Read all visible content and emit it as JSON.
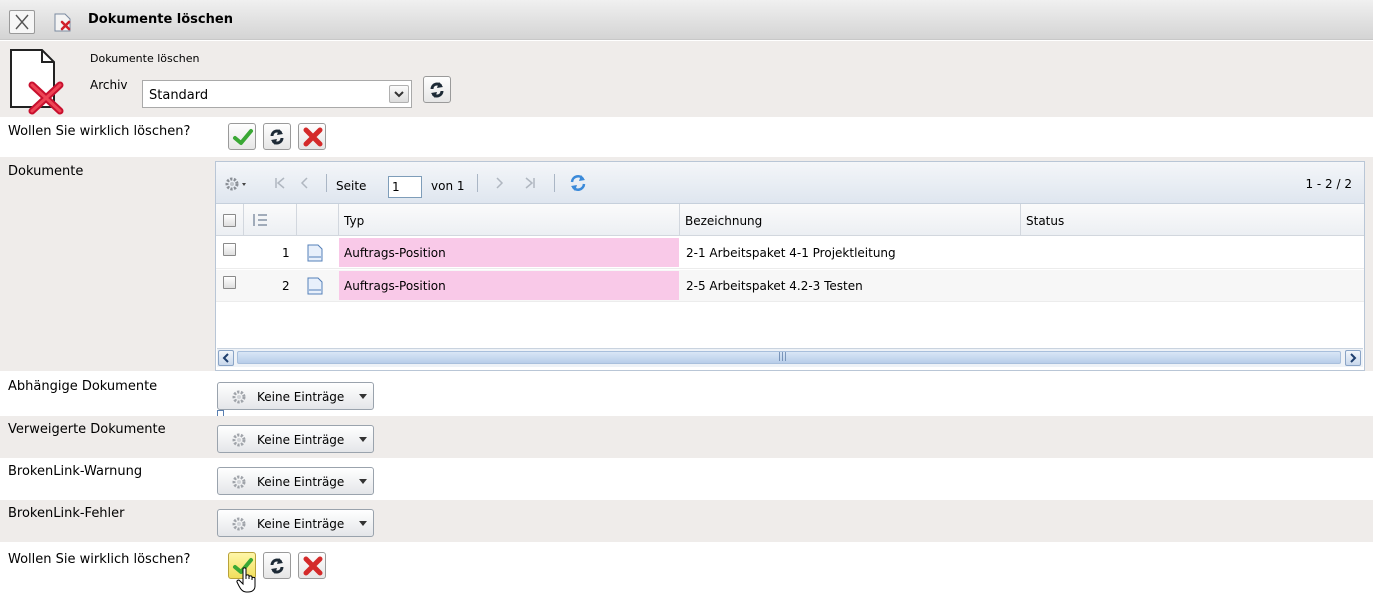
{
  "window": {
    "title": "Dokumente löschen"
  },
  "header": {
    "small_title": "Dokumente löschen",
    "archiv_label": "Archiv",
    "archiv_value": "Standard"
  },
  "confirm": {
    "question": "Wollen Sie wirklich löschen?"
  },
  "documents": {
    "label": "Dokumente",
    "toolbar": {
      "page_label": "Seite",
      "page_value": "1",
      "of_label": "von 1",
      "range": "1 - 2 / 2"
    },
    "columns": [
      "Typ",
      "Bezeichnung",
      "Status"
    ],
    "rows": [
      {
        "num": "1",
        "typ": "Auftrags-Position",
        "bezeichnung": "2-1 Arbeitspaket 4-1 Projektleitung",
        "status": ""
      },
      {
        "num": "2",
        "typ": "Auftrags-Position",
        "bezeichnung": "2-5 Arbeitspaket 4.2-3 Testen",
        "status": ""
      }
    ],
    "scroll_grip": "|||"
  },
  "sections": [
    {
      "label": "Abhängige Dokumente",
      "button": "Keine Einträge"
    },
    {
      "label": "Verweigerte Dokumente",
      "button": "Keine Einträge"
    },
    {
      "label": "BrokenLink-Warnung",
      "button": "Keine Einträge"
    },
    {
      "label": "BrokenLink-Fehler",
      "button": "Keine Einträge"
    }
  ],
  "icons": {
    "close": "close-icon",
    "delete_doc": "delete-document-icon",
    "refresh": "refresh-icon",
    "confirm": "checkmark-icon",
    "cancel": "red-x-icon",
    "gear": "gear-icon",
    "doc": "document-icon"
  },
  "colors": {
    "typ_highlight": "#f9c9e8",
    "band": "#efecea",
    "grid_border": "#b9c6d6"
  }
}
